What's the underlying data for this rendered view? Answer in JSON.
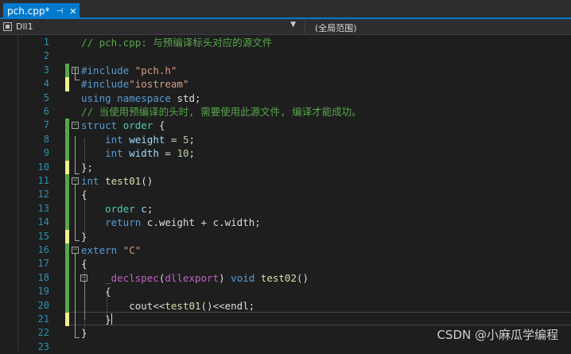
{
  "tab": {
    "title": "pch.cpp*",
    "pin_icon": "pin-icon",
    "close_icon": "close-icon"
  },
  "nav": {
    "project": "Dll1",
    "scope": "(全局范围)"
  },
  "lines": {
    "n1": "1",
    "n2": "2",
    "n3": "3",
    "n4": "4",
    "n5": "5",
    "n6": "6",
    "n7": "7",
    "n8": "8",
    "n9": "9",
    "n10": "10",
    "n11": "11",
    "n12": "12",
    "n13": "13",
    "n14": "14",
    "n15": "15",
    "n16": "16",
    "n17": "17",
    "n18": "18",
    "n19": "19",
    "n20": "20",
    "n21": "21",
    "n22": "22",
    "n23": "23"
  },
  "code": {
    "l1": "// pch.cpp: 与预编译标头对应的源文件",
    "l3": {
      "kw": "#include",
      "str": "\"pch.h\""
    },
    "l4": {
      "kw": "#include",
      "str": "\"iostream\""
    },
    "l5": {
      "kw1": "using",
      "kw2": "namespace",
      "rest": "std;"
    },
    "l6": "// 当使用预编译的头时, 需要使用此源文件, 编译才能成功。",
    "l7": {
      "kw": "struct",
      "type": "order",
      "rest": "{"
    },
    "l8": {
      "kw": "int",
      "var": "weight",
      "op": " = ",
      "num": "5",
      "end": ";"
    },
    "l9": {
      "kw": "int",
      "var": "width",
      "op": " = ",
      "num": "10",
      "end": ";"
    },
    "l10": "};",
    "l11": {
      "kw": "int",
      "fn": "test01",
      "rest": "()"
    },
    "l12": "{",
    "l13": {
      "type": "order",
      "var": "c",
      "end": ";"
    },
    "l14": {
      "kw": "return",
      "rest": "c.weight + c.width;"
    },
    "l15": "}",
    "l16": {
      "kw": "extern",
      "str": "\"C\""
    },
    "l17": "{",
    "l18": {
      "mac": "_declspec",
      "p1": "(",
      "arg": "dllexport",
      "p2": ")",
      "kw": "void",
      "fn": "test02",
      "rest": "()"
    },
    "l19": "{",
    "l20": {
      "pre": "cout<<",
      "fn": "test01",
      "rest": "()<<endl;"
    },
    "l21": "}",
    "l22": "}"
  },
  "watermark": "CSDN @小麻瓜学编程",
  "colors": {
    "tab_active": "#007acc",
    "background": "#1e1e1e",
    "line_number": "#2b91af",
    "comment": "#57a64a",
    "keyword": "#569cd6",
    "string": "#d69d85",
    "type": "#4ec9b0",
    "change_saved": "#57a64a",
    "change_unsaved": "#efef91"
  }
}
